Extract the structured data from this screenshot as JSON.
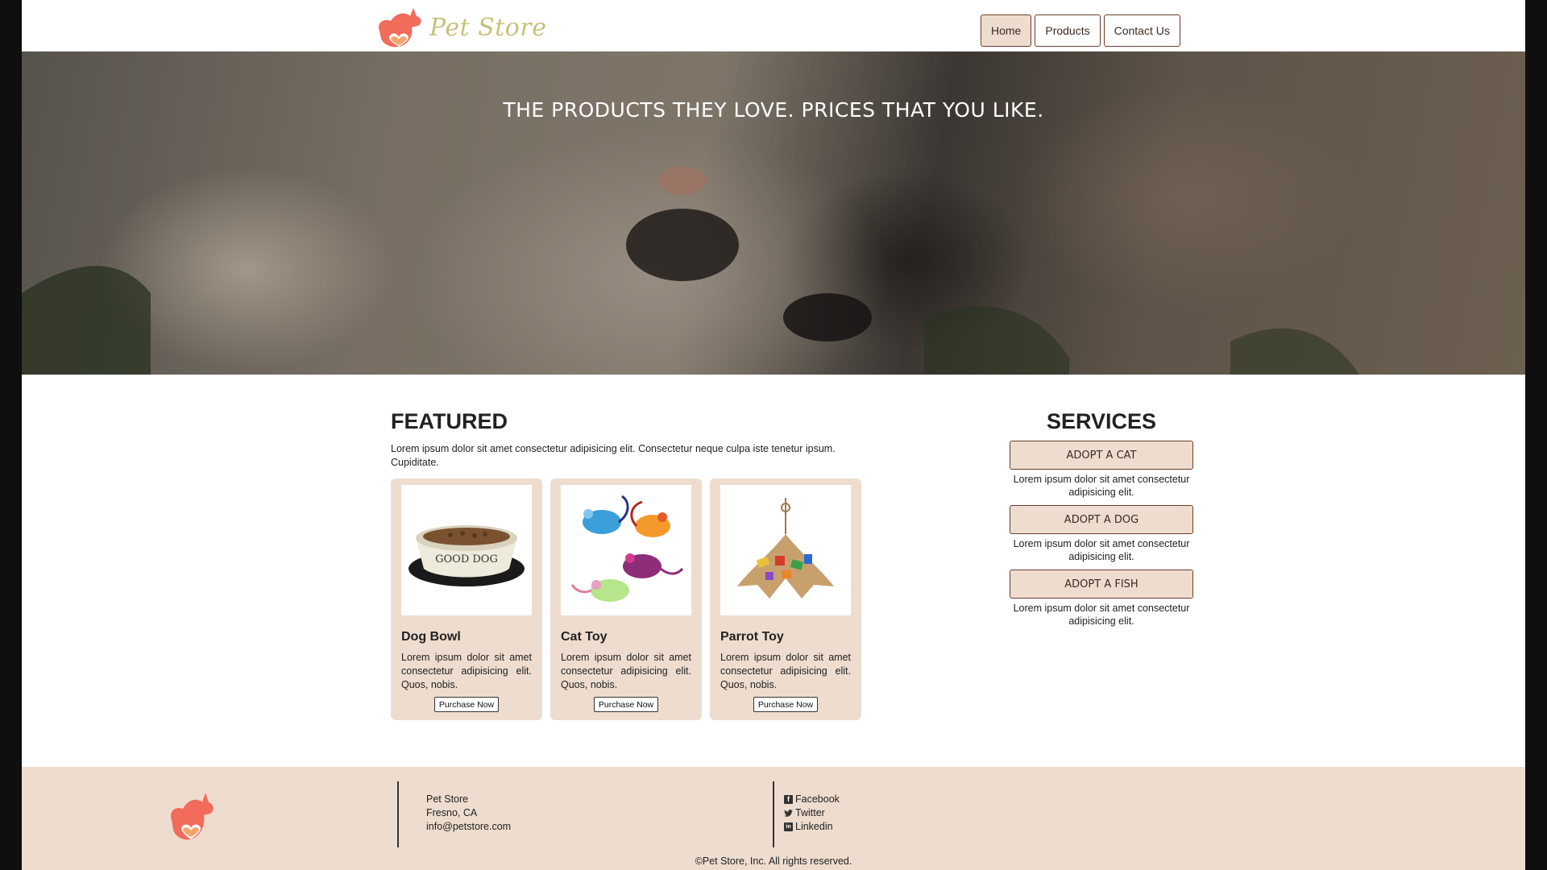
{
  "header": {
    "logo_text": "Pet Store",
    "nav": [
      {
        "label": "Home",
        "active": true
      },
      {
        "label": "Products",
        "active": false
      },
      {
        "label": "Contact Us",
        "active": false
      }
    ]
  },
  "hero": {
    "title": "THE PRODUCTS THEY LOVE. PRICES THAT YOU LIKE."
  },
  "featured": {
    "title": "FEATURED",
    "description": "Lorem ipsum dolor sit amet consectetur adipisicing elit. Consectetur neque culpa iste tenetur ipsum. Cupiditate.",
    "products": [
      {
        "name": "Dog Bowl",
        "text": "Lorem ipsum dolor sit amet consectetur adipisicing elit. Quos, nobis.",
        "button": "Purchase Now",
        "image_icon": "dog-bowl-icon",
        "bowl_label": "GOOD DOG"
      },
      {
        "name": "Cat Toy",
        "text": "Lorem ipsum dolor sit amet consectetur adipisicing elit. Quos, nobis.",
        "button": "Purchase Now",
        "image_icon": "toy-mice-icon"
      },
      {
        "name": "Parrot Toy",
        "text": "Lorem ipsum dolor sit amet consectetur adipisicing elit. Quos, nobis.",
        "button": "Purchase Now",
        "image_icon": "parrot-toy-icon"
      }
    ]
  },
  "services": {
    "title": "SERVICES",
    "items": [
      {
        "label": "ADOPT A CAT",
        "text": "Lorem ipsum dolor sit amet consectetur adipisicing elit."
      },
      {
        "label": "ADOPT A DOG",
        "text": "Lorem ipsum dolor sit amet consectetur adipisicing elit."
      },
      {
        "label": "ADOPT A FISH",
        "text": "Lorem ipsum dolor sit amet consectetur adipisicing elit."
      }
    ]
  },
  "footer": {
    "info": {
      "name": "Pet Store",
      "city": "Fresno, CA",
      "email": "info@petstore.com"
    },
    "social": [
      {
        "label": "Facebook",
        "icon": "facebook-icon"
      },
      {
        "label": "Twitter",
        "icon": "twitter-icon"
      },
      {
        "label": "Linkedin",
        "icon": "linkedin-icon"
      }
    ],
    "copyright": "©Pet Store, Inc. All rights reserved."
  },
  "colors": {
    "accent_bg": "#eeddcf",
    "button_border": "#6b3d2b",
    "logo_coral": "#f26b5b",
    "logo_text": "#c8c07a"
  }
}
